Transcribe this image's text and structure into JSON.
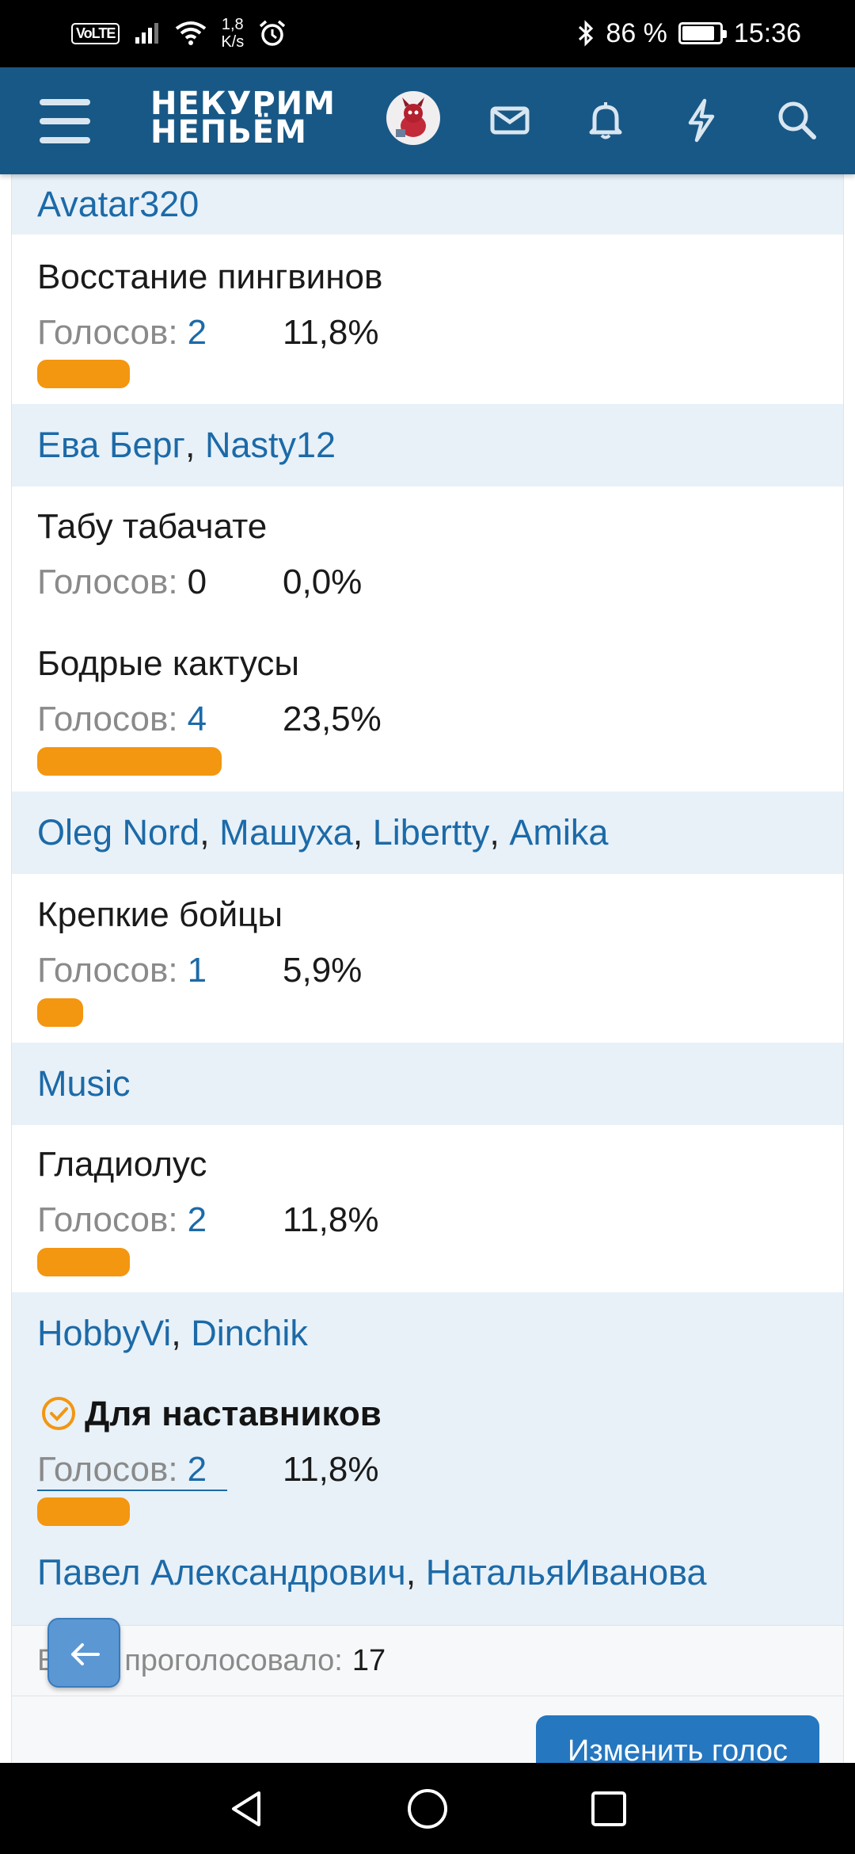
{
  "status_bar": {
    "volte": "VoLTE",
    "net_speed_value": "1,8",
    "net_speed_unit": "K/s",
    "battery": "86 %",
    "time": "15:36"
  },
  "header": {
    "logo_line1": "НЕКУРИМ",
    "logo_line2": "НЕПЬЁМ"
  },
  "poll": {
    "votes_label": "Голосов:",
    "groups": [
      {
        "voters": [
          "Avatar320"
        ]
      },
      {
        "title": "Восстание пингвинов",
        "count": "2",
        "percent": "11,8%",
        "share": 0.118
      },
      {
        "voters": [
          "Ева Берг",
          "Nasty12"
        ]
      },
      {
        "title": "Табу табачате",
        "count": "0",
        "percent": "0,0%",
        "share": 0.0
      },
      {
        "title": "Бодрые кактусы",
        "count": "4",
        "percent": "23,5%",
        "share": 0.235
      },
      {
        "voters": [
          "Oleg Nord",
          "Машуха",
          "Libertty",
          "Amika"
        ]
      },
      {
        "title": "Крепкие бойцы",
        "count": "1",
        "percent": "5,9%",
        "share": 0.059
      },
      {
        "voters": [
          "Music"
        ]
      },
      {
        "title": "Гладиолус",
        "count": "2",
        "percent": "11,8%",
        "share": 0.118
      },
      {
        "voters": [
          "HobbyVi",
          "Dinchik"
        ]
      },
      {
        "title": "Для наставников",
        "count": "2",
        "percent": "11,8%",
        "share": 0.118,
        "selected": true
      },
      {
        "voters": [
          "Павел Александрович",
          "НатальяИванова"
        ]
      }
    ],
    "total_label": "Всего проголосовало:",
    "total_value": "17",
    "change_vote_label": "Изменить голос"
  },
  "colors": {
    "header_bg": "#185886",
    "accent_blue": "#1c6aa8",
    "bar_orange": "#f39610",
    "voters_bg": "#e8f1f8",
    "button_blue": "#2577c0"
  }
}
